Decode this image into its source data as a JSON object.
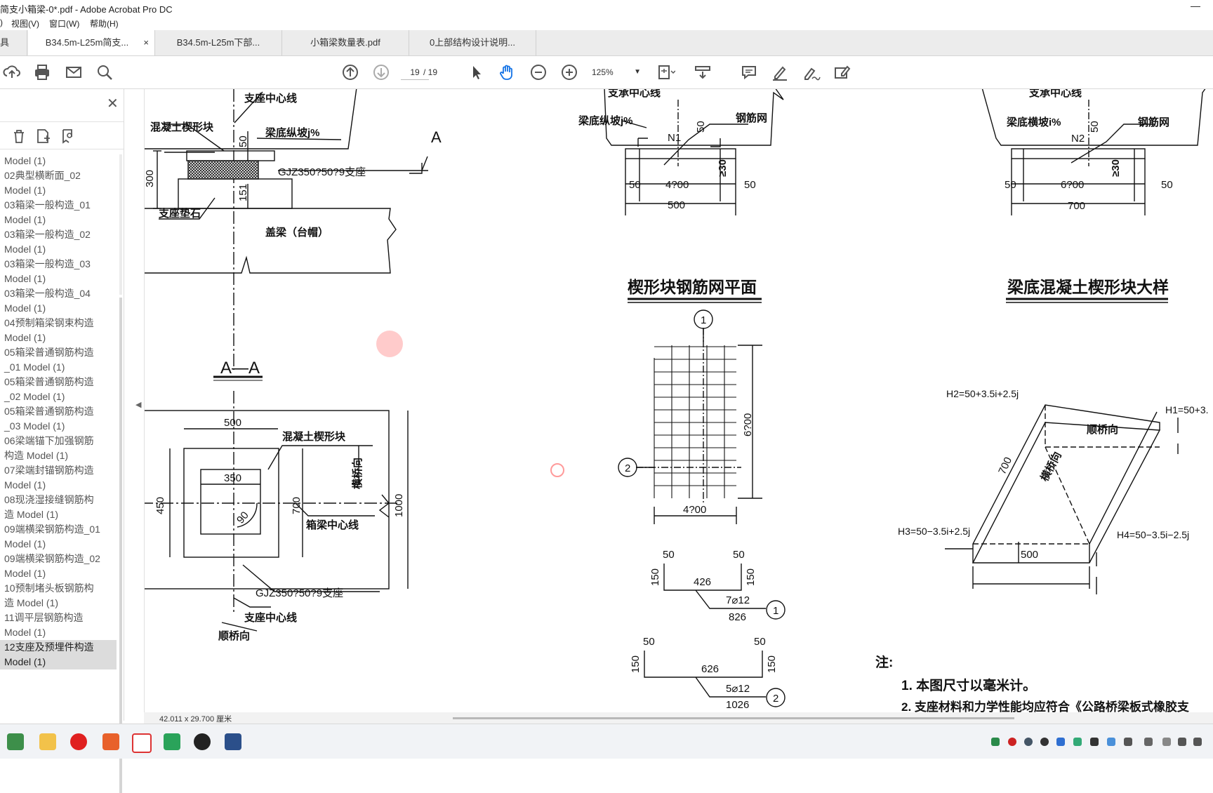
{
  "window": {
    "title": "简支小箱梁-0*.pdf - Adobe Acrobat Pro DC",
    "minimize": "—"
  },
  "menu": {
    "items": [
      "视图(V)",
      "窗口(W)",
      "帮助(H)"
    ],
    "left_fragment": ")"
  },
  "tabs": {
    "left_fragment": "具",
    "items": [
      {
        "label": "B34.5m-L25m简支...",
        "active": true
      },
      {
        "label": "B34.5m-L25m下部..."
      },
      {
        "label": "小箱梁数量表.pdf"
      },
      {
        "label": "0上部结构设计说明..."
      }
    ],
    "close": "×"
  },
  "toolbar": {
    "page_current": "19",
    "page_total": "/ 19",
    "zoom": "125%",
    "zoom_caret": "▼",
    "help": "?"
  },
  "sidebar": {
    "close": "✕",
    "bookmarks": [
      "Model (1)",
      "02典型横断面_02",
      "Model (1)",
      "03箱梁一般构造_01",
      "Model (1)",
      "03箱梁一般构造_02",
      "Model (1)",
      "03箱梁一般构造_03",
      "Model (1)",
      "03箱梁一般构造_04",
      "Model (1)",
      "04预制箱梁钢束构造",
      "Model (1)",
      "05箱梁普通钢筋构造",
      "_01 Model (1)",
      "05箱梁普通钢筋构造",
      "_02 Model (1)",
      "05箱梁普通钢筋构造",
      "_03 Model (1)",
      "06梁端锚下加强钢筋",
      "构造 Model (1)",
      "07梁端封锚钢筋构造",
      "Model (1)",
      "08现浇湿接缝钢筋构",
      "造 Model (1)",
      "09端横梁钢筋构造_01",
      "Model (1)",
      "09端横梁钢筋构造_02",
      "Model (1)",
      "10预制堵头板钢筋构",
      "造 Model (1)",
      "11调平层钢筋构造",
      "Model (1)",
      "12支座及预埋件构造",
      "Model (1)"
    ],
    "selected_from": 33
  },
  "status": {
    "dimensions": "42.011 x 29.700 厘米"
  },
  "drawing": {
    "labels": {
      "support_center": "支座中心线",
      "wedge": "混凝土楔形块",
      "slope_long": "梁底纵坡j%",
      "bearing": "GJZ350?50?9支座",
      "pad": "支座垫石",
      "cap": "盖梁（台帽）",
      "d300": "300",
      "d50a": "50",
      "d151": "151",
      "secA": "A",
      "aa": "A—A",
      "d500a": "500",
      "d350": "350",
      "d450": "450",
      "d700a": "700",
      "d1000": "1000",
      "d90": "90",
      "trans": "横桥向",
      "boxcenter": "箱梁中心线",
      "bearing2": "GJZ350?50?9支座",
      "support_center2": "支座中心线",
      "along": "顺桥向",
      "tc1": "支承中心线",
      "slope_long2": "梁底纵坡j%",
      "mesh1": "钢筋网",
      "n1": "N1",
      "d50b": "50",
      "d50c": "50",
      "d50d": "50",
      "d4200": "4?00",
      "d500b": "500",
      "d30a": "≥30",
      "tc2": "支承中心线",
      "slope_tr": "梁底横坡i%",
      "mesh2": "钢筋网",
      "n2": "N2",
      "d50e": "50",
      "d50f": "50",
      "d50g": "50",
      "d6200": "6?00",
      "d700b": "700",
      "d30b": "≥30",
      "title_mesh": "楔形块钢筋网平面",
      "title_wedge": "梁底混凝土楔形块大样",
      "c1": "1",
      "c2": "2",
      "d6200v": "6?00",
      "d4200b": "4?00",
      "r1_50a": "50",
      "r1_50b": "50",
      "r1_150a": "150",
      "r1_150b": "150",
      "r1_426": "426",
      "r1_spec": "7⌀12",
      "r1_826": "826",
      "r2_50a": "50",
      "r2_50b": "50",
      "r2_150a": "150",
      "r2_150b": "150",
      "r2_626": "626",
      "r2_spec": "5⌀12",
      "r2_1026": "1026",
      "h2": "H2=50+3.5i+2.5j",
      "h1": "H1=50+3.",
      "along2": "顺桥向",
      "trans2": "横桥向",
      "d700c": "700",
      "h3": "H3=50−3.5i+2.5j",
      "h4": "H4=50−3.5i−2.5j",
      "d500c": "500",
      "note": "注:",
      "note1": "1. 本图尺寸以毫米计。",
      "note2": "2. 支座材料和力学性能均应符合《公路桥梁板式橡胶支"
    }
  },
  "colors": {
    "accent": "#1473e6",
    "ink": "#111111"
  }
}
